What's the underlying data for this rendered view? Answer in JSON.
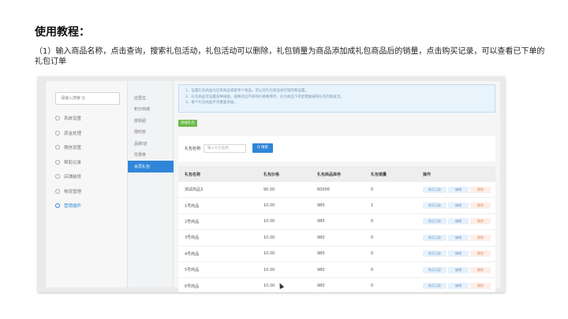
{
  "slide": {
    "title": "使用教程：",
    "description": "（1）输入商品名称，点击查询，搜索礼包活动，礼包活动可以删除，礼包销量为商品添加成礼包商品后的销量，点击购买记录，可以查看已下单的礼包订单"
  },
  "sidebar": {
    "search_placeholder": "请输入搜索 Q",
    "items": [
      {
        "label": "系统设置",
        "active": false
      },
      {
        "label": "资金处理",
        "active": false
      },
      {
        "label": "微信设置",
        "active": false
      },
      {
        "label": "帮助记录",
        "active": false
      },
      {
        "label": "店铺装修",
        "active": false
      },
      {
        "label": "物流管理",
        "active": false
      },
      {
        "label": "营销插件",
        "active": true
      }
    ]
  },
  "subnav": {
    "items": [
      {
        "label": "店里位",
        "active": false
      },
      {
        "label": "积分商城",
        "active": false
      },
      {
        "label": "拼购团",
        "active": false
      },
      {
        "label": "限时抢",
        "active": false
      },
      {
        "label": "品牌/店",
        "active": false
      },
      {
        "label": "优惠券",
        "active": false
      },
      {
        "label": "会员礼包",
        "active": true
      }
    ]
  },
  "main": {
    "notice_lines": [
      "1、设置礼包商品为已有商品或者单个商品，可以对礼包商品进行操作和设置。",
      "2、礼包商品可设置多种规格，规格对应不同的价格和库存，礼包商品下单后需要按照礼包内容发货。",
      "3、每个礼包商品不可重复添加。"
    ],
    "add_button": "添加礼包",
    "search": {
      "label": "礼包名称:",
      "placeholder": "输入礼包名称",
      "button": "Q 搜索"
    },
    "table": {
      "headers": [
        "礼包名称",
        "礼包价格",
        "礼包商品库存",
        "礼包销量",
        "操作"
      ],
      "rows": [
        {
          "name": "测试商品3",
          "price": "90.00",
          "stock": "60006",
          "sales": "0"
        },
        {
          "name": "1号商品",
          "price": "10.00",
          "stock": "980",
          "sales": "1"
        },
        {
          "name": "2号商品",
          "price": "10.00",
          "stock": "980",
          "sales": "0"
        },
        {
          "name": "3号商品",
          "price": "10.00",
          "stock": "980",
          "sales": "0"
        },
        {
          "name": "4号商品",
          "price": "10.00",
          "stock": "980",
          "sales": "0"
        },
        {
          "name": "5号商品",
          "price": "10.00",
          "stock": "980",
          "sales": "0"
        },
        {
          "name": "6号商品",
          "price": "10.00",
          "stock": "980",
          "sales": "0"
        }
      ],
      "actions": {
        "buy": "购买记录",
        "edit": "编辑",
        "delete": "删除"
      }
    }
  },
  "colors": {
    "accent": "#2f86d8",
    "add_button": "#6cb94a",
    "delete_action": "#d9906a"
  }
}
